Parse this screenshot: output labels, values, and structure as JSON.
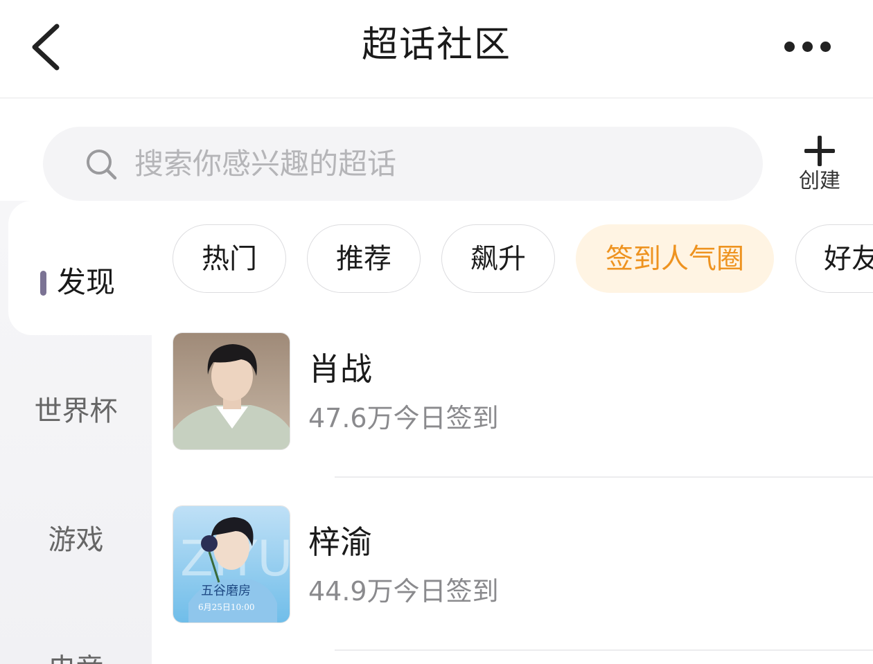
{
  "header": {
    "title": "超话社区",
    "back_icon": "chevron-left-icon",
    "more_icon": "more-horizontal-icon"
  },
  "search": {
    "placeholder": "搜索你感兴趣的超话",
    "icon": "search-icon"
  },
  "create": {
    "label": "创建",
    "icon": "plus-icon"
  },
  "sidebar": {
    "items": [
      {
        "label": "发现",
        "active": true
      },
      {
        "label": "世界杯",
        "active": false
      },
      {
        "label": "游戏",
        "active": false
      },
      {
        "label": "电竞",
        "active": false
      }
    ],
    "active_indicator_color": "#7b7394"
  },
  "chips": [
    {
      "label": "热门",
      "active": false
    },
    {
      "label": "推荐",
      "active": false
    },
    {
      "label": "飙升",
      "active": false
    },
    {
      "label": "签到人气圈",
      "active": true
    },
    {
      "label": "好友",
      "active": false
    }
  ],
  "active_chip_colors": {
    "background": "#fff4e3",
    "text": "#ee9320"
  },
  "list": [
    {
      "name": "肖战",
      "count": "47.6万今日签到"
    },
    {
      "name": "梓渝",
      "count": "44.9万今日签到",
      "poster_text": "五谷磨房",
      "poster_date": "6月25日10:00"
    }
  ]
}
